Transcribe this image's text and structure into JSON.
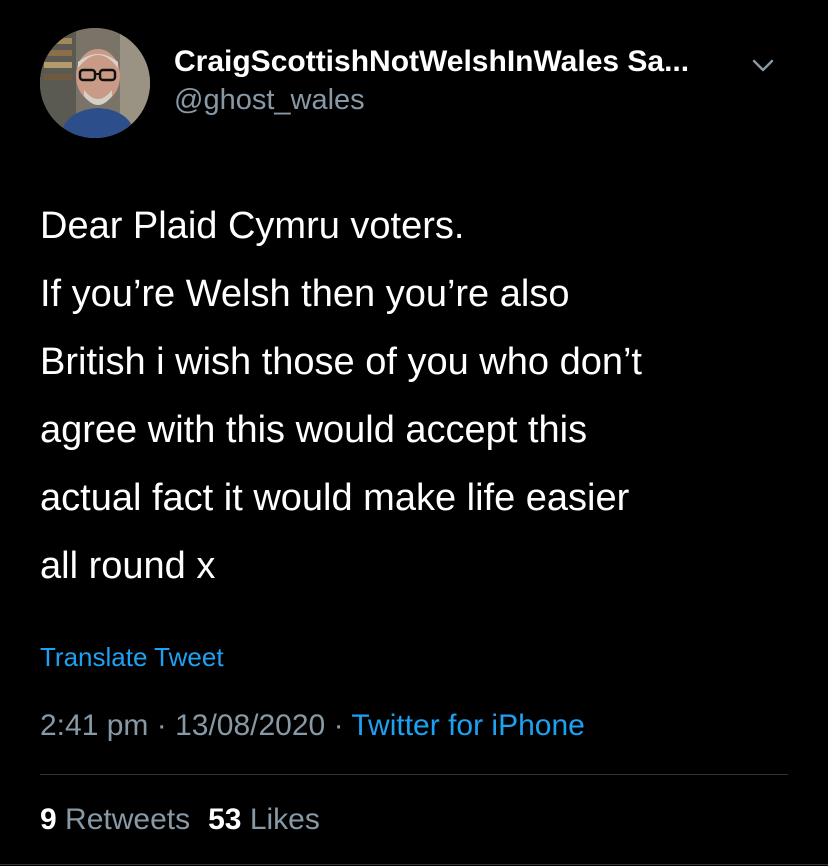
{
  "author": {
    "display_name": "CraigScottishNotWelshInWales Sa...",
    "handle": "@ghost_wales",
    "avatar_icon": "profile-photo"
  },
  "tweet": {
    "lines": [
      "Dear Plaid Cymru voters.",
      "If you’re Welsh then you’re also",
      "British i wish those of you who don’t",
      "agree with this would accept this",
      "actual fact it would make life easier",
      "all round x"
    ],
    "translate_label": "Translate Tweet",
    "time": "2:41 pm",
    "date": "13/08/2020",
    "separator": "·",
    "source": "Twitter for iPhone"
  },
  "stats": {
    "retweets_count": "9",
    "retweets_label": "Retweets",
    "likes_count": "53",
    "likes_label": "Likes"
  },
  "colors": {
    "background": "#000000",
    "text": "#ffffff",
    "secondary": "#8899a6",
    "accent": "#1da1f2",
    "divider": "#2f3336"
  },
  "icons": {
    "more": "chevron-down-icon"
  }
}
